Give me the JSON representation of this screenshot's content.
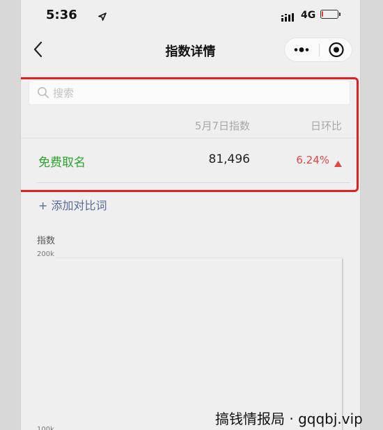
{
  "status_bar": {
    "time": "5:36",
    "network": "4G",
    "battery_level": 0.1,
    "battery_color": "#e53935"
  },
  "nav": {
    "title": "指数详情",
    "back_icon": "chevron-left-icon",
    "more_icon": "more-dots-icon",
    "close_icon": "target-icon"
  },
  "search": {
    "placeholder": "搜索",
    "value": ""
  },
  "table": {
    "headers": [
      "5月7日指数",
      "日环比"
    ],
    "rows": [
      {
        "keyword": "免费取名",
        "index": "81,496",
        "change": "6.24%",
        "trend": "up"
      }
    ]
  },
  "add_compare_label": "+ 添加对比词",
  "chart": {
    "title": "指数",
    "y_top_label": "200k",
    "y_bottom_label": "100k"
  },
  "watermark": "搞钱情报局 · gqqbj.vip",
  "colors": {
    "keyword": "#2aa52e",
    "change_up": "#e04545",
    "link": "#576b95",
    "highlight": "#e02020"
  }
}
